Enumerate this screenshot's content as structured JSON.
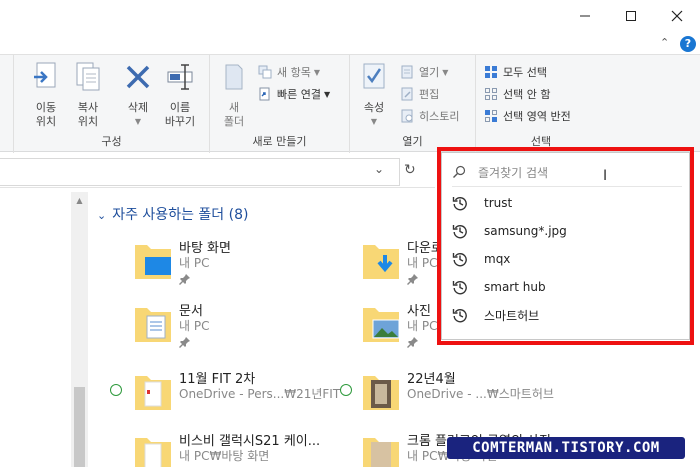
{
  "ribbon": {
    "organize": {
      "label": "구성",
      "move_to": "이동\n위치",
      "copy_to": "복사\n위치",
      "delete": "삭제",
      "rename": "이름\n바꾸기"
    },
    "new": {
      "label": "새로 만들기",
      "new_folder": "새\n폴더",
      "new_item": "새 항목",
      "easy_access": "빠른 연결"
    },
    "open": {
      "label": "열기",
      "properties": "속성",
      "open": "열기",
      "edit": "편집",
      "history": "히스토리"
    },
    "select": {
      "label": "선택",
      "select_all": "모두 선택",
      "select_none": "선택 안 함",
      "invert": "선택 영역 반전"
    }
  },
  "content": {
    "section_title": "자주 사용하는 폴더 (8)",
    "folders": [
      {
        "name": "바탕 화면",
        "location": "내 PC",
        "status": "pinned"
      },
      {
        "name": "다운로",
        "location": "내 PC",
        "status": "pinned"
      },
      {
        "name": "문서",
        "location": "내 PC",
        "status": "pinned"
      },
      {
        "name": "사진",
        "location": "내 PC",
        "status": "pinned"
      },
      {
        "name": "11월 FIT 2차",
        "location": "OneDrive - Pers...₩21년FIT",
        "status": "synced"
      },
      {
        "name": "22년4월",
        "location": "OneDrive - ...₩스마트허브",
        "status": "synced"
      },
      {
        "name": "비스비 갤럭시S21 케이...",
        "location": "내 PC₩바탕 화면",
        "status": ""
      },
      {
        "name": "크롬 플러그인 구역의 사진",
        "location": "내 PC₩바탕 화면",
        "status": ""
      }
    ]
  },
  "search": {
    "placeholder": "즐겨찾기 검색",
    "history": [
      "trust",
      "samsung*.jpg",
      "mqx",
      "smart hub",
      "스마트허브"
    ]
  },
  "watermark": "COMTERMAN.TISTORY.COM",
  "colors": {
    "accent": "#1e4e9c",
    "highlight_frame": "#ee1111",
    "folder": "#f8d775",
    "sync_ok": "#2e9a3c"
  }
}
